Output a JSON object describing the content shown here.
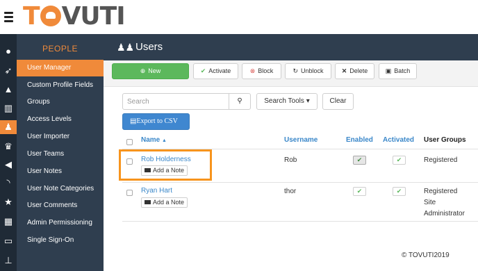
{
  "app": {
    "logo": "TOVUTI",
    "logo_pre": "T",
    "logo_post": "VUTI"
  },
  "sidebar": {
    "heading": "PEOPLE",
    "items": [
      {
        "label": "User Manager",
        "active": true
      },
      {
        "label": "Custom Profile Fields"
      },
      {
        "label": "Groups"
      },
      {
        "label": "Access Levels"
      },
      {
        "label": "User Importer"
      },
      {
        "label": "User Teams"
      },
      {
        "label": "User Notes"
      },
      {
        "label": "User Note Categories"
      },
      {
        "label": "User Comments"
      },
      {
        "label": "Admin Permissioning"
      },
      {
        "label": "Single Sign-On"
      }
    ]
  },
  "iconbar": [
    "elephant-icon",
    "rocket-icon",
    "graduation-cap-icon",
    "bar-chart-icon",
    "users-icon",
    "trophy-icon",
    "bullhorn-icon",
    "rss-icon",
    "star-icon",
    "table-icon",
    "credit-card-icon",
    "sitemap-icon"
  ],
  "header": {
    "title": "Users"
  },
  "toolbar": {
    "new": "New",
    "activate": "Activate",
    "block": "Block",
    "unblock": "Unblock",
    "delete": "Delete",
    "batch": "Batch"
  },
  "search": {
    "placeholder": "Search",
    "tools": "Search Tools",
    "clear": "Clear",
    "export": "Export to CSV"
  },
  "table": {
    "columns": {
      "name": "Name",
      "username": "Username",
      "enabled": "Enabled",
      "activated": "Activated",
      "groups": "User Groups"
    },
    "rows": [
      {
        "name": "Rob Holderness",
        "note": "Add a Note",
        "username": "Rob",
        "group_line1": "Registered",
        "group_line2": "",
        "group_line3": ""
      },
      {
        "name": "Ryan Hart",
        "note": "Add a Note",
        "username": "thor",
        "group_line1": "Registered",
        "group_line2": "Site",
        "group_line3": "Administrator"
      }
    ]
  },
  "footer": {
    "copyright": "© TOVUTI2019"
  },
  "colors": {
    "accent": "#f08a3a",
    "sidebar": "#2f3e4f",
    "link": "#3a87c9",
    "success": "#5cb85c"
  }
}
